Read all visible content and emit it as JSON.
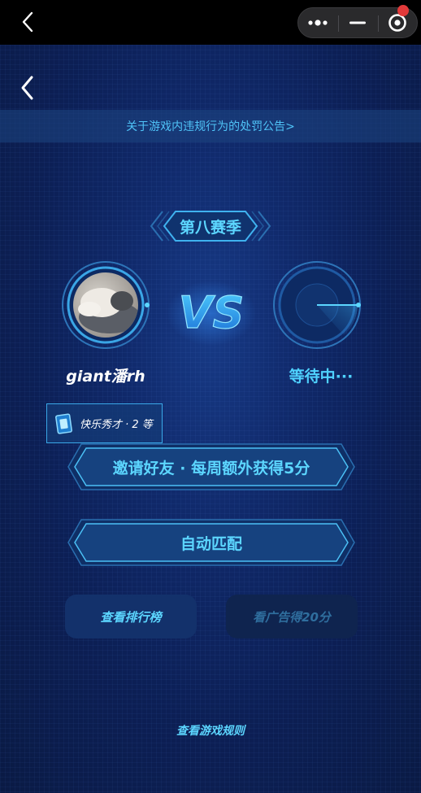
{
  "notice": {
    "text": "关于游戏内违规行为的处罚公告>"
  },
  "season": {
    "label": "第八赛季"
  },
  "match": {
    "vs_label": "VS",
    "player_name": "giant潘rh",
    "opponent_status": "等待中···"
  },
  "rank": {
    "text": "快乐秀才 · 2 等"
  },
  "buttons": {
    "invite": "邀请好友 · 每周额外获得5分",
    "auto_match": "自动匹配",
    "leaderboard": "查看排行榜",
    "watch_ad": "看广告得20分"
  },
  "footer": {
    "rules_link": "查看游戏规则"
  },
  "icons": {
    "top_back": "chevron-left-icon",
    "more": "more-dots-icon",
    "minimize": "minus-icon",
    "close": "target-icon",
    "back": "chevron-left-icon",
    "rank_badge": "card-icon"
  },
  "colors": {
    "accent": "#5cd6ff",
    "background": "#0b1c45",
    "notification_dot": "#e23a3a"
  }
}
